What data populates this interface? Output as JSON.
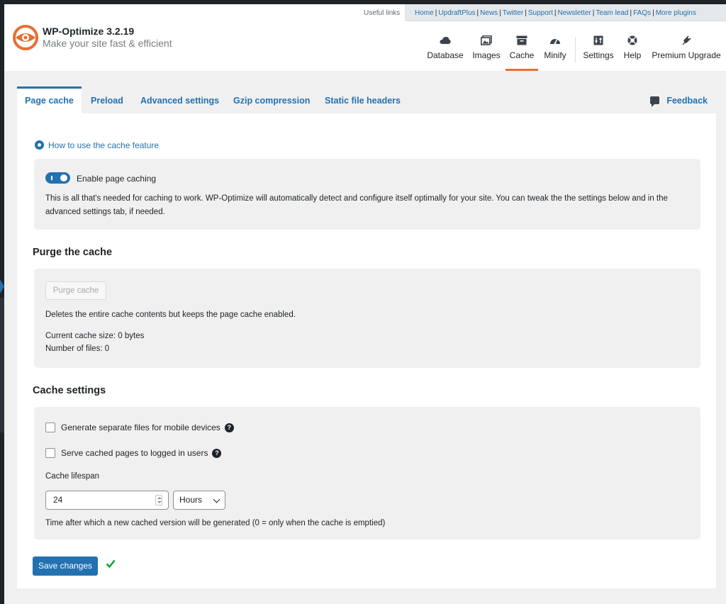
{
  "header": {
    "useful_links_label": "Useful links",
    "links": [
      "Home",
      "UpdraftPlus",
      "News",
      "Twitter",
      "Support",
      "Newsletter",
      "Team lead",
      "FAQs",
      "More plugins"
    ],
    "brand_title": "WP-Optimize 3.2.19",
    "brand_subtitle": "Make your site fast & efficient",
    "brand_color": "#e66f35",
    "nav": [
      {
        "label": "Database",
        "icon": "cloud-icon"
      },
      {
        "label": "Images",
        "icon": "images-icon"
      },
      {
        "label": "Cache",
        "icon": "archive-icon",
        "active": true
      },
      {
        "label": "Minify",
        "icon": "dashboard-icon"
      },
      {
        "label": "Settings",
        "icon": "settings-icon"
      },
      {
        "label": "Help",
        "icon": "lifebuoy-icon"
      },
      {
        "label": "Premium Upgrade",
        "icon": "plug-icon"
      }
    ]
  },
  "tabs": [
    {
      "label": "Page cache",
      "active": true
    },
    {
      "label": "Preload"
    },
    {
      "label": "Advanced settings"
    },
    {
      "label": "Gzip compression"
    },
    {
      "label": "Static file headers"
    }
  ],
  "feedback_label": "Feedback",
  "howto_link": "How to use the cache feature",
  "enable_caching": {
    "label": "Enable page caching",
    "checked": true,
    "description": "This is all that's needed for caching to work. WP-Optimize will automatically detect and configure itself optimally for your site. You can tweak the the settings below and in the advanced settings tab, if needed."
  },
  "purge": {
    "heading": "Purge the cache",
    "button_label": "Purge cache",
    "description": "Deletes the entire cache contents but keeps the page cache enabled.",
    "cache_size": "Current cache size: 0 bytes",
    "file_count": "Number of files: 0"
  },
  "settings": {
    "heading": "Cache settings",
    "mobile_label": "Generate separate files for mobile devices",
    "logged_in_label": "Serve cached pages to logged in users",
    "lifespan_label": "Cache lifespan",
    "lifespan_value": "24",
    "lifespan_unit": "Hours",
    "lifespan_help": "Time after which a new cached version will be generated (0 = only when the cache is emptied)"
  },
  "save_label": "Save changes",
  "accent_color": "#2271b1"
}
